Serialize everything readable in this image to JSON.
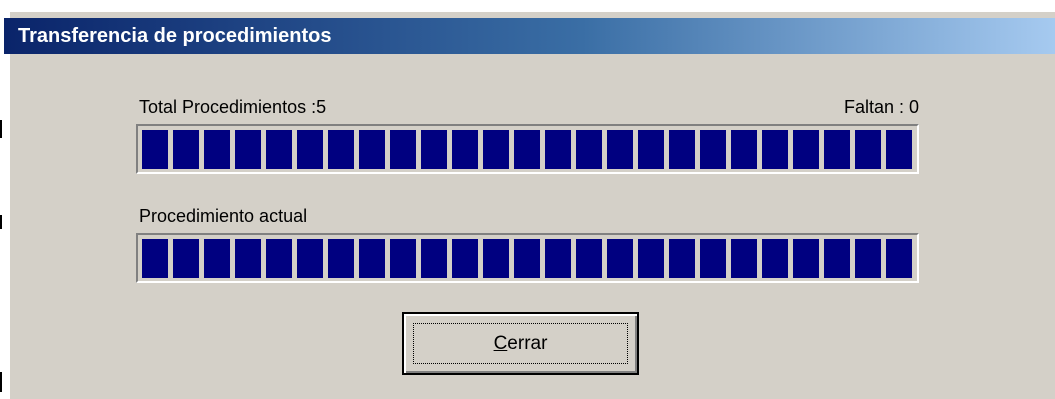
{
  "window": {
    "title": "Transferencia de procedimientos"
  },
  "total_progress": {
    "label": "Total Procedimientos :5",
    "remaining_label": "Faltan : 0",
    "fraction": 1.0
  },
  "current_progress": {
    "label": "Procedimiento actual",
    "fraction": 1.0
  },
  "close_button": {
    "mnemonic": "C",
    "rest": "errar"
  },
  "colors": {
    "title_bar_start": "#0a246a",
    "title_bar_end": "#a6caf0",
    "progress_fill": "#000080",
    "dialog_face": "#d4d0c8"
  }
}
